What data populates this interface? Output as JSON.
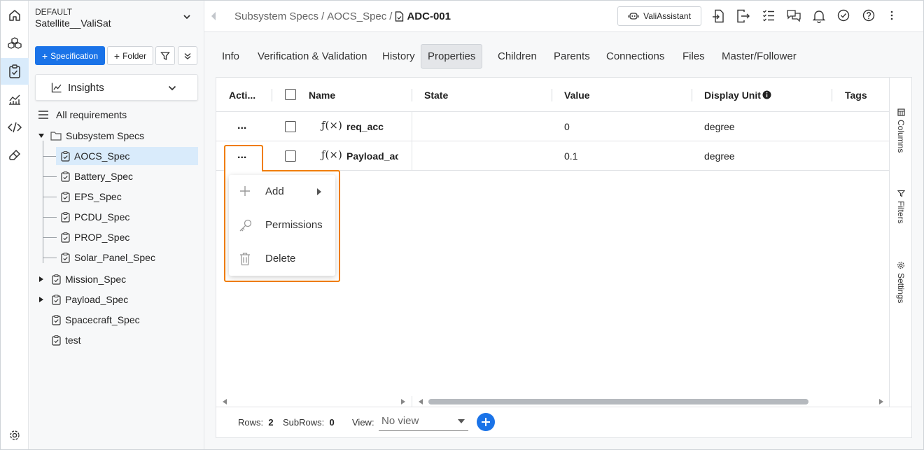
{
  "project": {
    "label": "DEFAULT",
    "name": "Satellite__ValiSat"
  },
  "sidebar": {
    "spec_button": "Specification",
    "folder_button": "Folder",
    "insights_label": "Insights",
    "all_requirements": "All requirements",
    "tree": {
      "subsystem": "Subsystem Specs",
      "children": [
        "AOCS_Spec",
        "Battery_Spec",
        "EPS_Spec",
        "PCDU_Spec",
        "PROP_Spec",
        "Solar_Panel_Spec"
      ],
      "others": [
        {
          "label": "Mission_Spec",
          "expandable": true
        },
        {
          "label": "Payload_Spec",
          "expandable": true
        },
        {
          "label": "Spacecraft_Spec",
          "expandable": false
        },
        {
          "label": "test",
          "expandable": false
        }
      ]
    }
  },
  "header": {
    "breadcrumb_1": "Subsystem Specs",
    "breadcrumb_2": "AOCS_Spec",
    "sep": "/",
    "current": "ADC-001",
    "assistant": "ValiAssistant"
  },
  "tabs": [
    "Info",
    "Verification & Validation",
    "History",
    "Properties",
    "Children",
    "Parents",
    "Connections",
    "Files",
    "Master/Follower"
  ],
  "table": {
    "columns": {
      "actions": "Acti...",
      "name": "Name",
      "state": "State",
      "value": "Value",
      "unit": "Display Unit",
      "tags": "Tags"
    },
    "rows": [
      {
        "actions": "...",
        "name": "req_acc",
        "value": "0",
        "unit": "degree"
      },
      {
        "actions": "...",
        "name": "Payload_ac",
        "value": "0.1",
        "unit": "degree"
      }
    ]
  },
  "fx_label": "ƒ(×)",
  "side_panel": {
    "columns": "Columns",
    "filters": "Filters",
    "settings": "Settings"
  },
  "footer": {
    "rows_label": "Rows:",
    "rows_value": "2",
    "subrows_label": "SubRows:",
    "subrows_value": "0",
    "view_label": "View:",
    "view_placeholder": "No view"
  },
  "context_menu": {
    "add": "Add",
    "permissions": "Permissions",
    "delete": "Delete"
  },
  "colors": {
    "accent": "#1a73e8",
    "highlight": "#f07d00",
    "selected": "#d9ebfb"
  }
}
